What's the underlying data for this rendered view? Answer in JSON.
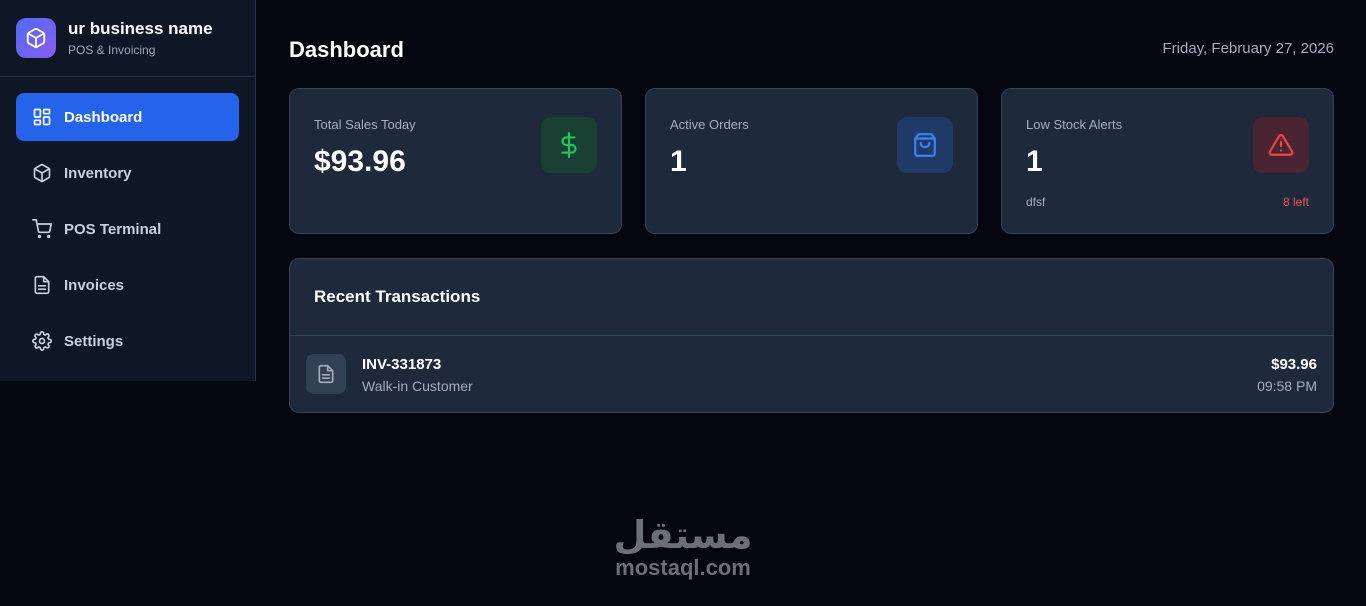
{
  "brand": {
    "name": "ur business name",
    "subtitle": "POS & Invoicing",
    "logo_icon": "package-icon"
  },
  "sidebar": {
    "items": [
      {
        "label": "Dashboard",
        "icon": "dashboard-grid-icon",
        "active": true
      },
      {
        "label": "Inventory",
        "icon": "box-icon",
        "active": false
      },
      {
        "label": "POS Terminal",
        "icon": "cart-icon",
        "active": false
      },
      {
        "label": "Invoices",
        "icon": "file-text-icon",
        "active": false
      },
      {
        "label": "Settings",
        "icon": "gear-icon",
        "active": false
      }
    ]
  },
  "header": {
    "title": "Dashboard",
    "date": "Friday, February 27, 2026"
  },
  "stats": [
    {
      "label": "Total Sales Today",
      "value": "$93.96",
      "icon": "dollar-icon",
      "accent": "#22c55e"
    },
    {
      "label": "Active Orders",
      "value": "1",
      "icon": "shopping-bag-icon",
      "accent": "#3b82f6"
    },
    {
      "label": "Low Stock Alerts",
      "value": "1",
      "icon": "alert-triangle-icon",
      "accent": "#ef4444",
      "item_name": "dfsf",
      "item_status": "8 left"
    }
  ],
  "transactions": {
    "title": "Recent Transactions",
    "rows": [
      {
        "id": "INV-331873",
        "customer": "Walk-in Customer",
        "amount": "$93.96",
        "time": "09:58 PM",
        "icon": "file-text-icon"
      }
    ]
  },
  "watermark": {
    "arabic": "مستقل",
    "latin": "mostaql.com"
  },
  "colors": {
    "background": "#03050f",
    "sidebar": "#0f1626",
    "card": "#1e293b",
    "active_nav": "#2563eb",
    "danger": "#f05252"
  }
}
